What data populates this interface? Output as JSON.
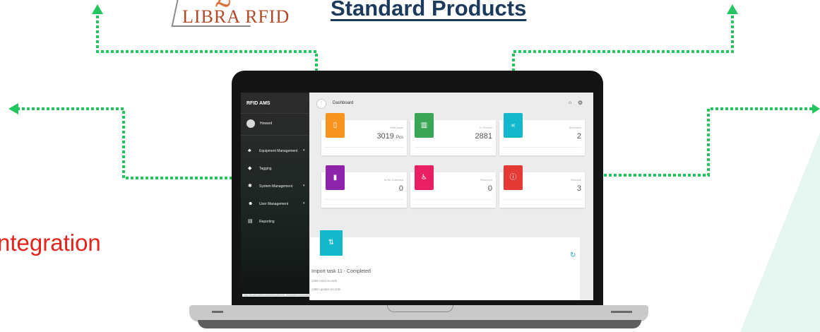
{
  "header": {
    "logo_text": "LIBRA RFID",
    "title": "Standard Products"
  },
  "side_text": "ntegration",
  "colors": {
    "connector": "#22c55e",
    "title": "#1b3a5c",
    "side_text": "#e8221c",
    "card_orange": "#f7941d",
    "card_green": "#3aa655",
    "card_teal": "#14b8cc",
    "card_purple": "#8e24aa",
    "card_pink": "#e91e63",
    "card_red": "#e53935"
  },
  "app": {
    "brand": "RFID AMS",
    "user": "Howard",
    "nav": [
      {
        "label": "Equipment Management",
        "icon": "users-icon"
      },
      {
        "label": "Tagging",
        "icon": "tag-icon"
      },
      {
        "label": "System Management",
        "icon": "gear-icon"
      },
      {
        "label": "User Management",
        "icon": "user-group-icon"
      },
      {
        "label": "Reporting",
        "icon": "report-icon"
      }
    ],
    "page_title": "Dashboard",
    "cards": [
      {
        "label": "Total Asset",
        "value": "3019",
        "unit": "Pcs",
        "icon": "document-icon",
        "color": "#f7941d"
      },
      {
        "label": "In Service",
        "value": "2881",
        "unit": "",
        "icon": "store-icon",
        "color": "#3aa655"
      },
      {
        "label": "Borrowed",
        "value": "2",
        "unit": "",
        "icon": "reply-all-icon",
        "color": "#14b8cc"
      },
      {
        "label": "To Be Collected",
        "value": "0",
        "unit": "",
        "icon": "book-icon",
        "color": "#8e24aa"
      },
      {
        "label": "Reserved",
        "value": "0",
        "unit": "",
        "icon": "walking-icon",
        "color": "#e91e63"
      },
      {
        "label": "Overdue",
        "value": "3",
        "unit": "",
        "icon": "alert-circle-icon",
        "color": "#e53935"
      }
    ],
    "import": {
      "title": "Import task 11 - Completed",
      "line1": "1386 total records",
      "line2": "1386 update records"
    },
    "status_url": "http://localhost/devs/assets/public/rfid_ams/admin/user/dashboard"
  }
}
